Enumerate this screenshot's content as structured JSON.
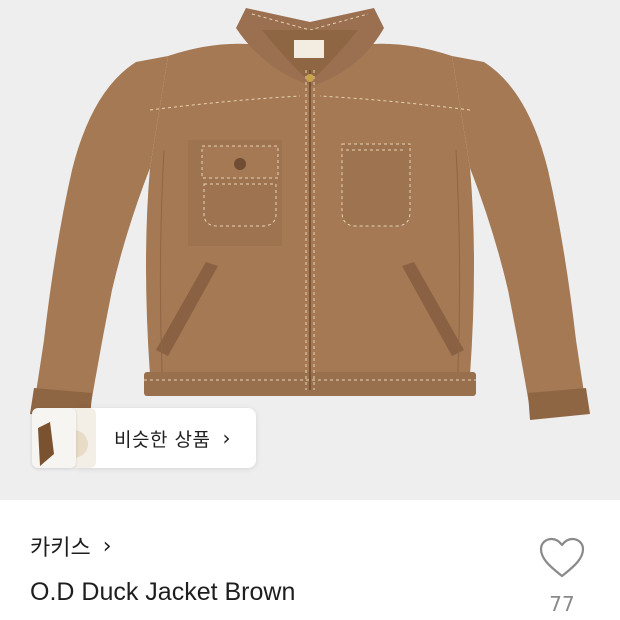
{
  "similar": {
    "label": "비슷한 상품",
    "chevron": "›"
  },
  "product": {
    "brand": "카키스",
    "brand_chevron": "›",
    "title": "O.D Duck Jacket Brown",
    "like_count": "77"
  },
  "colors": {
    "jacket": "#a47954",
    "jacket_dark": "#8f6644",
    "stitch": "#e7d3b6",
    "background": "#eeeeef"
  },
  "icons": {
    "like": "heart-icon",
    "similar_chevron": "chevron-right-icon",
    "brand_chevron": "chevron-right-icon"
  }
}
